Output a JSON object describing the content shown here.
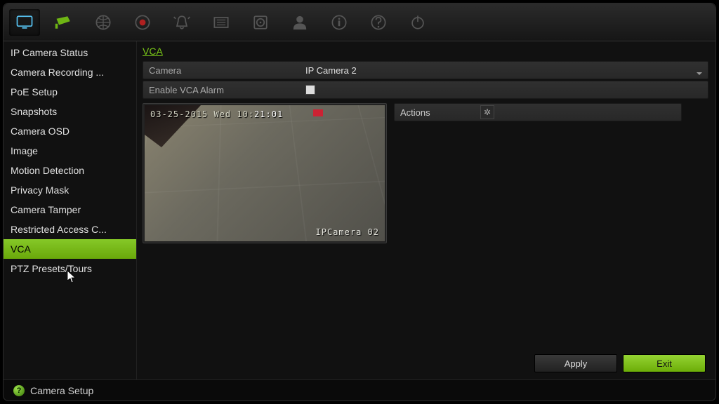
{
  "toolbar": {
    "icons": [
      "monitor",
      "camera",
      "globe",
      "record",
      "alarm",
      "schedule",
      "hdd",
      "user",
      "info",
      "help",
      "power"
    ],
    "active_index": 1
  },
  "sidebar": {
    "items": [
      {
        "label": "IP Camera Status"
      },
      {
        "label": "Camera Recording ..."
      },
      {
        "label": "PoE Setup"
      },
      {
        "label": "Snapshots"
      },
      {
        "label": "Camera OSD"
      },
      {
        "label": "Image"
      },
      {
        "label": "Motion Detection"
      },
      {
        "label": "Privacy Mask"
      },
      {
        "label": "Camera Tamper"
      },
      {
        "label": "Restricted Access C..."
      },
      {
        "label": "VCA"
      },
      {
        "label": "PTZ Presets/Tours"
      }
    ],
    "active_index": 10
  },
  "breadcrumb": "VCA",
  "form": {
    "camera_label": "Camera",
    "camera_value": "IP Camera 2",
    "enable_vca_label": "Enable VCA Alarm",
    "enable_vca_checked": false,
    "actions_label": "Actions"
  },
  "preview": {
    "timestamp_prefix": "03-25-2015 Wed 10:",
    "timestamp_highlight": "21:01",
    "camera_label": "IPCamera 02"
  },
  "buttons": {
    "apply": "Apply",
    "exit": "Exit"
  },
  "status": "Camera Setup"
}
